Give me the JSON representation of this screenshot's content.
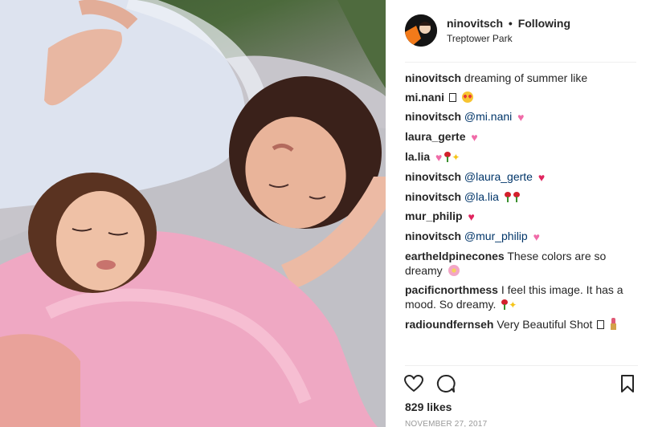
{
  "post": {
    "username": "ninovitsch",
    "separator": "•",
    "follow_state": "Following",
    "location": "Treptower Park",
    "likes": "829 likes",
    "date": "NOVEMBER 27, 2017"
  },
  "comments": [
    {
      "user": "ninovitsch",
      "text": "dreaming of summer like",
      "mention": "",
      "emoji": []
    },
    {
      "user": "mi.nani",
      "text": "",
      "mention": "",
      "emoji": [
        "box",
        "heart-eyes"
      ]
    },
    {
      "user": "ninovitsch",
      "text": "",
      "mention": "@mi.nani",
      "emoji": [
        "heart-pink"
      ]
    },
    {
      "user": "laura_gerte",
      "text": "",
      "mention": "",
      "emoji": [
        "heart-pink"
      ]
    },
    {
      "user": "la.lia",
      "text": "",
      "mention": "",
      "emoji": [
        "heart-pink",
        "rose",
        "sparkles"
      ]
    },
    {
      "user": "ninovitsch",
      "text": "",
      "mention": "@laura_gerte",
      "emoji": [
        "heart-red"
      ]
    },
    {
      "user": "ninovitsch",
      "text": "",
      "mention": "@la.lia",
      "emoji": [
        "rose",
        "rose"
      ]
    },
    {
      "user": "mur_philip",
      "text": "",
      "mention": "",
      "emoji": [
        "heart-red"
      ]
    },
    {
      "user": "ninovitsch",
      "text": "",
      "mention": "@mur_philip",
      "emoji": [
        "heart-pink"
      ]
    },
    {
      "user": "eartheldpinecones",
      "text": "These colors are so dreamy",
      "mention": "",
      "emoji": [
        "blossom"
      ]
    },
    {
      "user": "pacificnorthmess",
      "text": "I feel this image. It has a mood. So dreamy.",
      "mention": "",
      "emoji": [
        "rose",
        "sparkles"
      ]
    },
    {
      "user": "radioundfernseh",
      "text": "Very Beautiful Shot",
      "mention": "",
      "emoji": [
        "box",
        "lipstick"
      ]
    }
  ],
  "icons": {
    "like": "heart-outline-icon",
    "comment": "speech-bubble-icon",
    "save": "bookmark-icon"
  },
  "colors": {
    "text": "#262626",
    "mention": "#003569",
    "muted": "#999999",
    "divider": "#efefef",
    "heart_red": "#e0245e",
    "heart_pink": "#f06ba8"
  }
}
